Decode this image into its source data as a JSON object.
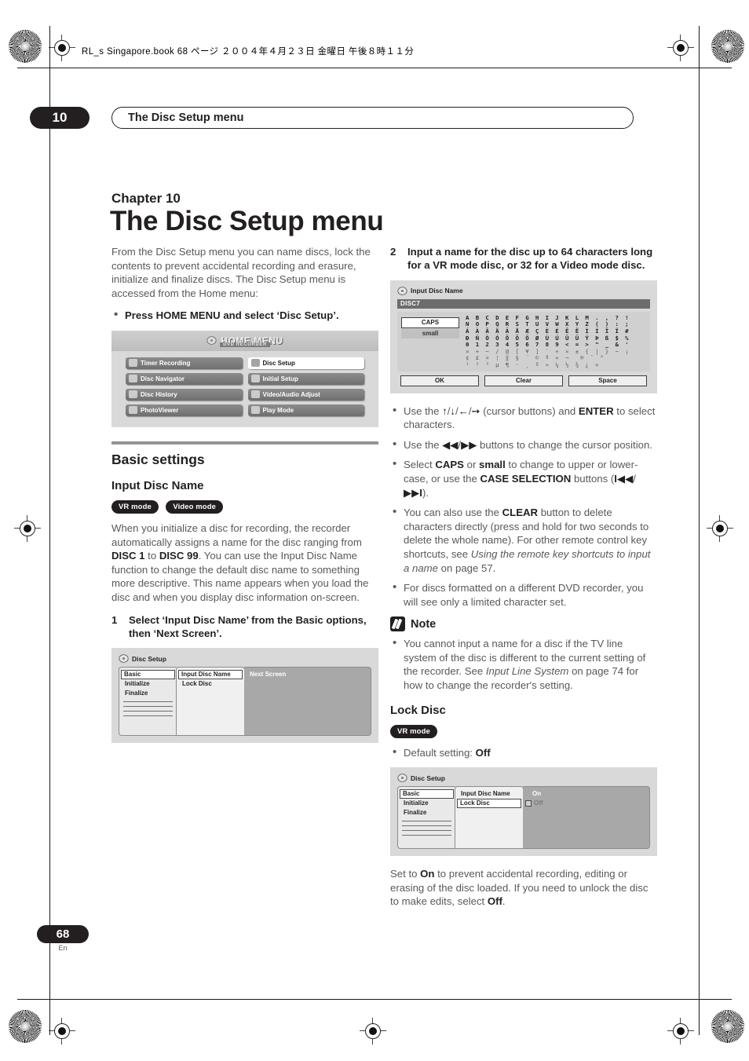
{
  "print_header": "RL_s Singapore.book  68 ページ  ２００４年４月２３日  金曜日  午後８時１１分",
  "running_head": {
    "chapter_number": "10",
    "title": "The Disc Setup menu"
  },
  "title_block": {
    "chapter_label": "Chapter 10",
    "chapter_title": "The Disc Setup menu"
  },
  "left_column": {
    "intro": "From the Disc Setup menu you can name discs, lock the contents to prevent accidental recording and erasure, initialize and finalize discs. The Disc Setup menu is accessed from the Home menu:",
    "intro_bullet": "Press HOME MENU and select ‘Disc Setup’.",
    "home_menu_shot": {
      "logo": "HOME MENU",
      "sublogo": "DVD RECORDER",
      "left_items": [
        {
          "label": "Timer Recording",
          "icon": "clock-icon",
          "selected": false
        },
        {
          "label": "Disc Navigator",
          "icon": "disc-navigator-icon",
          "selected": false
        },
        {
          "label": "Disc History",
          "icon": "history-icon",
          "selected": false
        },
        {
          "label": "PhotoViewer",
          "icon": "photo-icon",
          "selected": false
        }
      ],
      "right_items": [
        {
          "label": "Disc Setup",
          "icon": "disc-setup-icon",
          "selected": true
        },
        {
          "label": "Initial Setup",
          "icon": "gear-icon",
          "selected": false
        },
        {
          "label": "Video/Audio Adjust",
          "icon": "adjust-icon",
          "selected": false
        },
        {
          "label": "Play Mode",
          "icon": "play-icon",
          "selected": false
        }
      ]
    },
    "section_title": "Basic settings",
    "subsection_title": "Input Disc Name",
    "badges": [
      "VR mode",
      "Video mode"
    ],
    "paragraph": "When you initialize a disc for recording, the recorder automatically assigns a name for the disc ranging from DISC 1 to DISC 99. You can use the Input Disc Name function to change the default disc name to something more descriptive. This name appears when you load the disc and when you display disc information on-screen.",
    "para_bold_1": "DISC 1",
    "para_bold_2": "DISC 99",
    "step1_number": "1",
    "step1_text": "Select ‘Input Disc Name’ from the Basic options, then ‘Next Screen’.",
    "disc_setup_shot": {
      "title": "Disc Setup",
      "col1": [
        "Basic",
        "Initialize",
        "Finalize"
      ],
      "col1_selected": "Basic",
      "col2": [
        "Input Disc Name",
        "Lock Disc"
      ],
      "col2_selected": "Input Disc Name",
      "col3": [
        "Next Screen"
      ]
    }
  },
  "right_column": {
    "step2_number": "2",
    "step2_text": "Input a name for the disc up to 64 characters long for a VR mode disc, or 32 for a Video mode disc.",
    "keyboard_shot": {
      "title": "Input Disc Name",
      "name_value": "DISC7",
      "cursor_char": "D",
      "case_options": [
        "CAPS",
        "small"
      ],
      "case_selected": "CAPS",
      "char_rows": [
        "A B C D E F G H I J K L M . , ? !",
        "N O P Q R S T U V W X Y Z ( ) : ;",
        "Á À Â Ä Ã Å Æ Ç È É Ê Ë Ì Í Î Ï #",
        "Ð Ñ Ò Ó Ô Õ Ö Ø Ù Ú Û Ü Ý Þ ß $ %",
        "0 1 2 3 4 5 6 7 8 9 < = > \" _ & '",
        "¤ + − / @ [ ¥ ] ` ÷ × ± { | } ~ ¡",
        "¢ £ ¤ ¦ ‖ § ¨ © ª « ¬ ­ ® ¯ °",
        "¹ ² ³ µ ¶ · ¸ º » ¼ ½ ¾ ¿ ×"
      ],
      "buttons": [
        "OK",
        "Clear",
        "Space"
      ]
    },
    "bullets": [
      "Use the ↑/↓/←/→ (cursor buttons) and ENTER to select characters.",
      "Use the ◀◀/▶▶ buttons to change the cursor position.",
      "Select CAPS or small to change to upper or lower-case, or use the CASE SELECTION buttons (I◀◀/ ▶▶I).",
      "You can also use the CLEAR button to delete characters directly (press and hold for two seconds to delete the whole name). For other remote control key shortcuts, see Using the remote key shortcuts to input a name on page 57.",
      "For discs formatted on a different DVD recorder, you will see only a limited character set."
    ],
    "note": {
      "title": "Note",
      "text": "You cannot input a name for a disc if the TV line system of the disc is different to the current setting of the recorder. See Input Line System on page 74 for how to change the recorder's setting.",
      "italic_ref": "Input Line System",
      "page_ref": "74"
    },
    "lock_disc": {
      "title": "Lock Disc",
      "badges": [
        "VR mode"
      ],
      "default_bullet_label": "Default setting:",
      "default_bullet_value": "Off",
      "shot": {
        "title": "Disc Setup",
        "col1": [
          "Basic",
          "Initialize",
          "Finalize"
        ],
        "col1_selected": "Basic",
        "col2": [
          "Input Disc Name",
          "Lock Disc"
        ],
        "col2_selected": "Lock Disc",
        "col3": [
          "On",
          "Off"
        ],
        "col3_current": "Off"
      },
      "closing_text": "Set to On to prevent accidental recording, editing or erasing of the disc loaded. If you need to unlock the disc to make edits, select Off."
    }
  },
  "footer": {
    "page_number": "68",
    "language": "En"
  }
}
